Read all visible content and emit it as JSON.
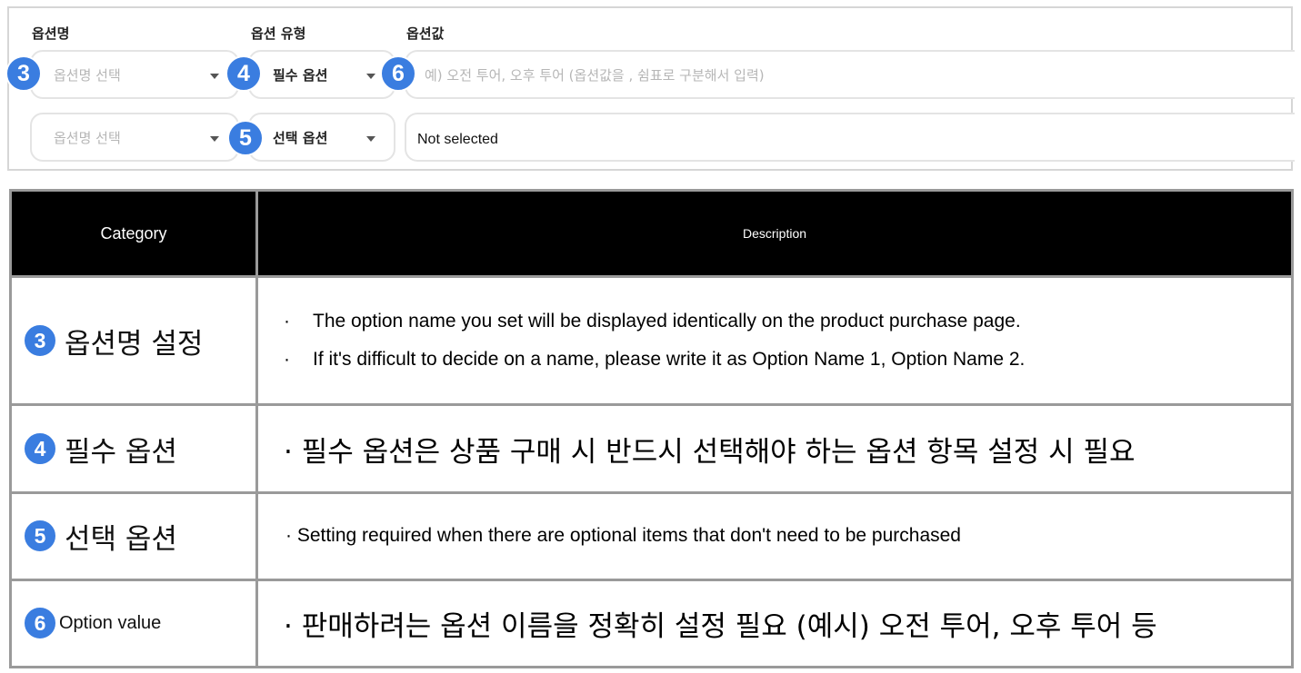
{
  "form": {
    "headers": {
      "name": "옵션명",
      "type": "옵션 유형",
      "value": "옵션값"
    },
    "rows": [
      {
        "badge_name": "3",
        "name_placeholder": "옵션명 선택",
        "badge_type": "4",
        "type_value": "필수 옵션",
        "badge_value": "6",
        "value_placeholder": "예) 오전 투어, 오후 투어 (옵션값을 , 쉼표로 구분해서 입력)"
      },
      {
        "name_placeholder": "옵션명 선택",
        "badge_type": "5",
        "type_value": "선택 옵션",
        "value_text": "Not selected"
      }
    ]
  },
  "table": {
    "headers": {
      "category": "Category",
      "description": "Description"
    },
    "rows": [
      {
        "badge": "3",
        "category": "옵션명 설정",
        "bullet": "·",
        "lines": [
          "The option name you set will be displayed identically on the product purchase page.",
          "If it's difficult to decide on a name, please write it as Option Name 1, Option Name 2."
        ]
      },
      {
        "badge": "4",
        "category": "필수 옵션",
        "text": "· 필수 옵션은 상품 구매 시 반드시 선택해야 하는 옵션 항목 설정 시 필요"
      },
      {
        "badge": "5",
        "category": "선택 옵션",
        "text": "· Setting required when there are optional items that don't need to be purchased"
      },
      {
        "badge": "6",
        "category": "Option value",
        "text": "· 판매하려는 옵션 이름을 정확히 설정 필요 (예시) 오전 투어, 오후 투어 등"
      }
    ]
  },
  "colors": {
    "badge": "#3a7de0",
    "header_bg": "#000000",
    "border": "#9a9a9a",
    "field_border": "#e4e4e4",
    "placeholder": "#b6b6b6"
  },
  "icons": {
    "dropdown": "chevron-down-icon"
  }
}
